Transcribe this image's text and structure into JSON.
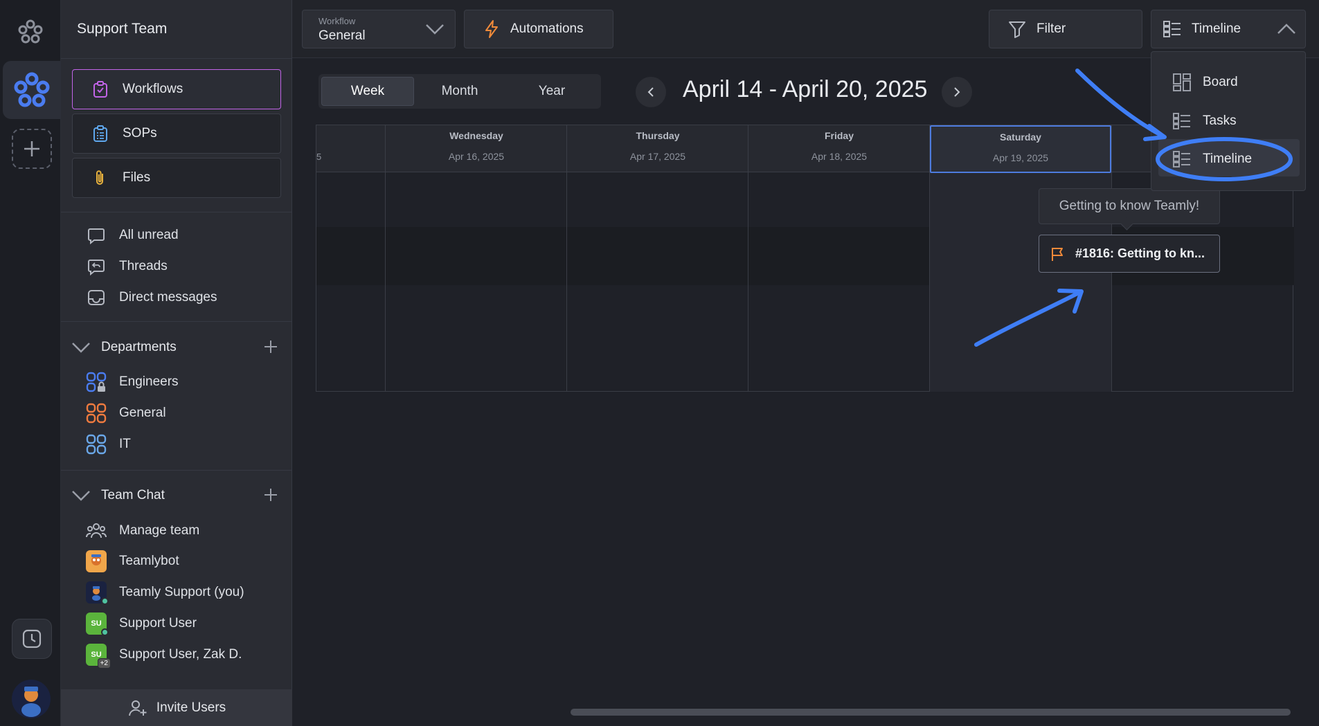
{
  "team": {
    "title": "Support Team"
  },
  "nav": {
    "workflows": "Workflows",
    "sops": "SOPs",
    "files": "Files"
  },
  "inbox": {
    "all_unread": "All unread",
    "threads": "Threads",
    "direct_messages": "Direct messages"
  },
  "departments": {
    "title": "Departments",
    "items": [
      {
        "label": "Engineers",
        "color": "#4a7cf0"
      },
      {
        "label": "General",
        "color": "#f07b3f"
      },
      {
        "label": "IT",
        "color": "#6aa7e8"
      }
    ]
  },
  "team_chat": {
    "title": "Team Chat",
    "manage": "Manage team",
    "items": [
      {
        "label": "Teamlybot"
      },
      {
        "label": "Teamly Support (you)"
      },
      {
        "label": "Support User",
        "initials": "SU"
      },
      {
        "label": "Support User, Zak D.",
        "initials": "SU",
        "extra": "+2"
      }
    ]
  },
  "invite": {
    "label": "Invite Users"
  },
  "toolbar": {
    "workflow_label": "Workflow",
    "workflow_value": "General",
    "automations": "Automations",
    "filter": "Filter",
    "view": "Timeline"
  },
  "calendar": {
    "tabs": [
      "Week",
      "Month",
      "Year"
    ],
    "active_tab": "Week",
    "range": "April 14 - April 20, 2025",
    "edge_fragment": "5",
    "days": [
      {
        "name": "Wednesday",
        "date": "Apr 16, 2025"
      },
      {
        "name": "Thursday",
        "date": "Apr 17, 2025"
      },
      {
        "name": "Friday",
        "date": "Apr 18, 2025"
      },
      {
        "name": "Saturday",
        "date": "Apr 19, 2025",
        "selected": true
      }
    ]
  },
  "event": {
    "tooltip": "Getting to know Teamly!",
    "label": "#1816: Getting to kn..."
  },
  "view_menu": {
    "options": [
      "Board",
      "Tasks",
      "Timeline"
    ],
    "selected": "Timeline"
  },
  "colors": {
    "accent": "#4d7bde",
    "workflow_border": "#c264e8",
    "annotation": "#3f7ef6"
  }
}
